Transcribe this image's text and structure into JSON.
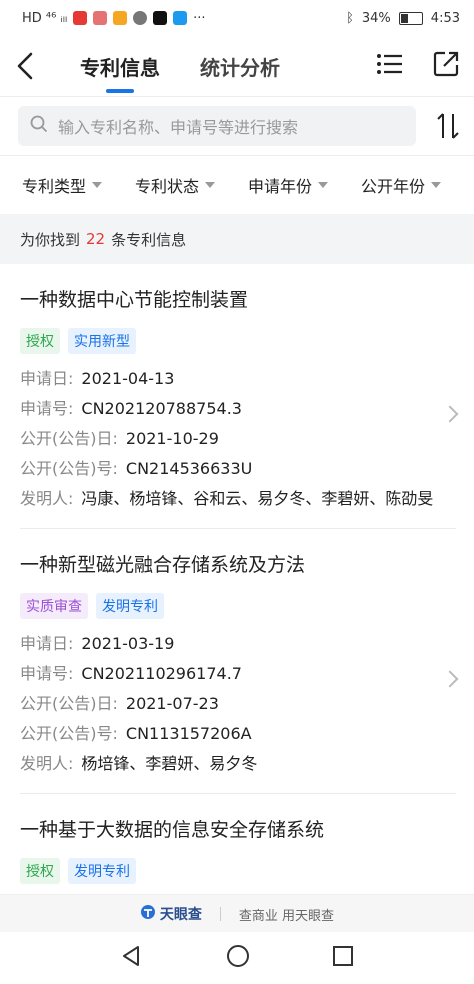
{
  "status_bar": {
    "left_text": "HD ⁴⁶ ᵢₗₗ",
    "battery_pct": "34%",
    "time": "4:53"
  },
  "nav": {
    "tabs": [
      {
        "label": "专利信息",
        "active": true
      },
      {
        "label": "统计分析",
        "active": false
      }
    ]
  },
  "search": {
    "placeholder": "输入专利名称、申请号等进行搜索"
  },
  "filters": [
    {
      "label": "专利类型"
    },
    {
      "label": "专利状态"
    },
    {
      "label": "申请年份"
    },
    {
      "label": "公开年份"
    }
  ],
  "result": {
    "prefix": "为你找到",
    "count": "22",
    "suffix": "条专利信息"
  },
  "patents": [
    {
      "title": "一种数据中心节能控制装置",
      "tags": [
        {
          "text": "授权",
          "color": "green"
        },
        {
          "text": "实用新型",
          "color": "blue"
        }
      ],
      "fields": [
        {
          "key": "申请日:",
          "value": "2021-04-13"
        },
        {
          "key": "申请号:",
          "value": "CN202120788754.3"
        },
        {
          "key": "公开(公告)日:",
          "value": "2021-10-29"
        },
        {
          "key": "公开(公告)号:",
          "value": "CN214536633U"
        },
        {
          "key": "发明人:",
          "value": "冯康、杨培锋、谷和云、易夕冬、李碧妍、陈劭旻"
        }
      ]
    },
    {
      "title": "一种新型磁光融合存储系统及方法",
      "tags": [
        {
          "text": "实质审查",
          "color": "purple"
        },
        {
          "text": "发明专利",
          "color": "blue"
        }
      ],
      "fields": [
        {
          "key": "申请日:",
          "value": "2021-03-19"
        },
        {
          "key": "申请号:",
          "value": "CN202110296174.7"
        },
        {
          "key": "公开(公告)日:",
          "value": "2021-07-23"
        },
        {
          "key": "公开(公告)号:",
          "value": "CN113157206A"
        },
        {
          "key": "发明人:",
          "value": "杨培锋、李碧妍、易夕冬"
        }
      ]
    },
    {
      "title": "一种基于大数据的信息安全存储系统",
      "tags": [
        {
          "text": "授权",
          "color": "green"
        },
        {
          "text": "发明专利",
          "color": "blue"
        }
      ],
      "fields": []
    }
  ],
  "footer": {
    "brand": "天眼查",
    "slogan": "查商业 用天眼查"
  },
  "colors": {
    "accent": "#1a73e8",
    "count_highlight": "#e53935"
  }
}
